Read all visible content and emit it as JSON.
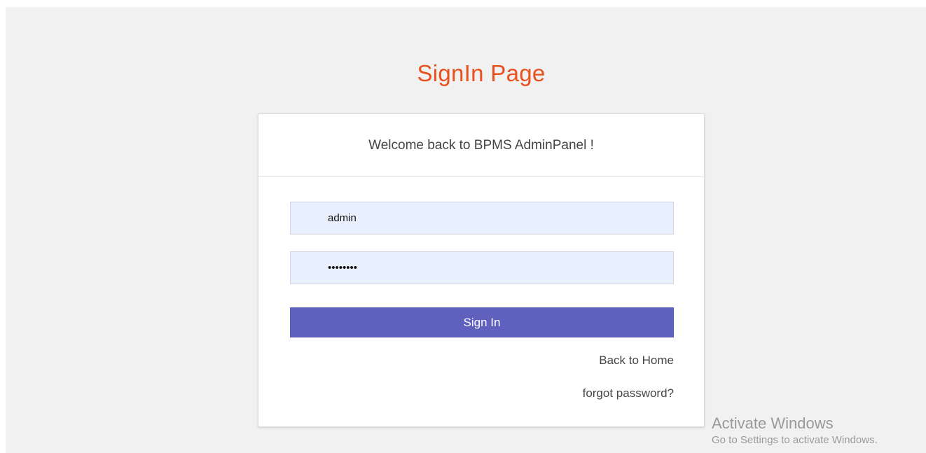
{
  "page": {
    "title": "SignIn Page"
  },
  "card": {
    "welcome": "Welcome back to BPMS AdminPanel !",
    "username_value": "admin",
    "password_value": "••••••••",
    "signin_label": "Sign In",
    "back_home_label": "Back to Home",
    "forgot_label": "forgot password?"
  },
  "watermark": {
    "title": "Activate Windows",
    "subtitle": "Go to Settings to activate Windows."
  },
  "colors": {
    "title": "#e8501e",
    "button": "#6060bf",
    "field_bg": "#e8f0fe",
    "page_bg": "#f1f1f1"
  }
}
